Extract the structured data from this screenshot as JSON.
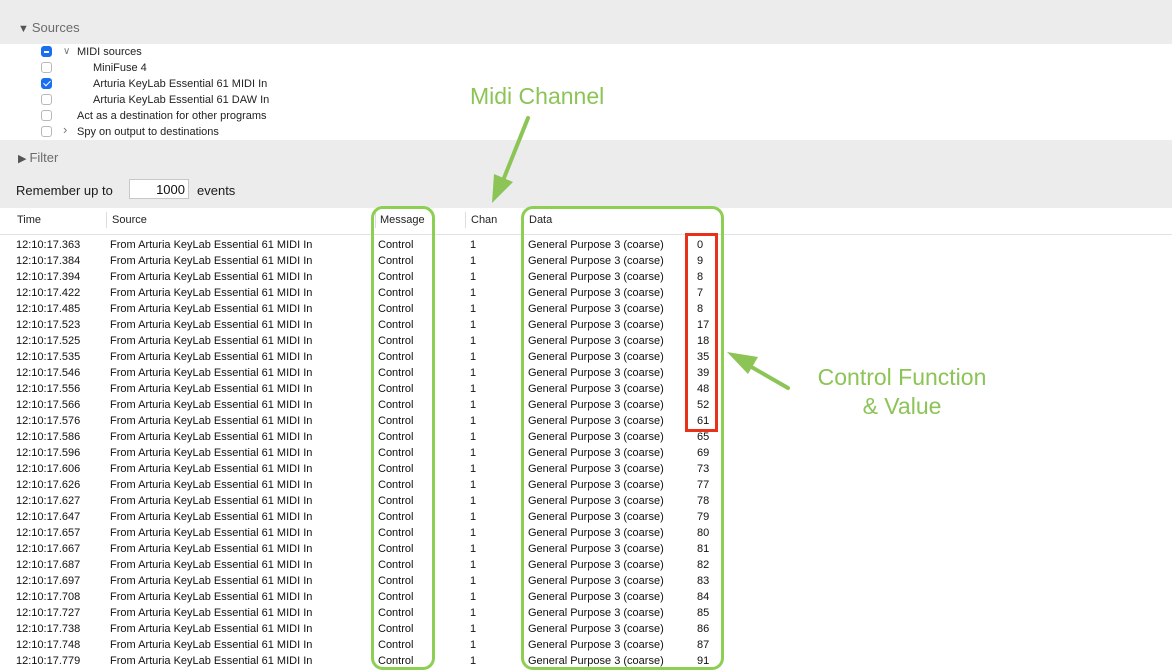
{
  "sources_panel": {
    "title": "Sources",
    "items": [
      {
        "label": "MIDI sources",
        "checkbox": "mixed",
        "expander": "down",
        "indent": 0
      },
      {
        "label": "MiniFuse 4",
        "checkbox": "unchecked",
        "expander": "",
        "indent": 1
      },
      {
        "label": "Arturia KeyLab Essential 61 MIDI In",
        "checkbox": "checked",
        "expander": "",
        "indent": 1
      },
      {
        "label": "Arturia KeyLab Essential 61 DAW In",
        "checkbox": "unchecked",
        "expander": "",
        "indent": 1
      },
      {
        "label": "Act as a destination for other programs",
        "checkbox": "unchecked",
        "expander": "",
        "indent": 0
      },
      {
        "label": "Spy on output to destinations",
        "checkbox": "unchecked",
        "expander": "right",
        "indent": 0
      }
    ]
  },
  "filter_panel": {
    "title": "Filter"
  },
  "remember": {
    "prefix": "Remember up to",
    "value": "1000",
    "suffix": "events"
  },
  "table": {
    "columns": [
      "Time",
      "Source",
      "Message",
      "Chan",
      "Data"
    ],
    "rows": [
      {
        "time": "12:10:17.363",
        "source": "From Arturia KeyLab Essential 61 MIDI In",
        "message": "Control",
        "chan": "1",
        "data": "General Purpose 3 (coarse)",
        "value": "0"
      },
      {
        "time": "12:10:17.384",
        "source": "From Arturia KeyLab Essential 61 MIDI In",
        "message": "Control",
        "chan": "1",
        "data": "General Purpose 3 (coarse)",
        "value": "9"
      },
      {
        "time": "12:10:17.394",
        "source": "From Arturia KeyLab Essential 61 MIDI In",
        "message": "Control",
        "chan": "1",
        "data": "General Purpose 3 (coarse)",
        "value": "8"
      },
      {
        "time": "12:10:17.422",
        "source": "From Arturia KeyLab Essential 61 MIDI In",
        "message": "Control",
        "chan": "1",
        "data": "General Purpose 3 (coarse)",
        "value": "7"
      },
      {
        "time": "12:10:17.485",
        "source": "From Arturia KeyLab Essential 61 MIDI In",
        "message": "Control",
        "chan": "1",
        "data": "General Purpose 3 (coarse)",
        "value": "8"
      },
      {
        "time": "12:10:17.523",
        "source": "From Arturia KeyLab Essential 61 MIDI In",
        "message": "Control",
        "chan": "1",
        "data": "General Purpose 3 (coarse)",
        "value": "17"
      },
      {
        "time": "12:10:17.525",
        "source": "From Arturia KeyLab Essential 61 MIDI In",
        "message": "Control",
        "chan": "1",
        "data": "General Purpose 3 (coarse)",
        "value": "18"
      },
      {
        "time": "12:10:17.535",
        "source": "From Arturia KeyLab Essential 61 MIDI In",
        "message": "Control",
        "chan": "1",
        "data": "General Purpose 3 (coarse)",
        "value": "35"
      },
      {
        "time": "12:10:17.546",
        "source": "From Arturia KeyLab Essential 61 MIDI In",
        "message": "Control",
        "chan": "1",
        "data": "General Purpose 3 (coarse)",
        "value": "39"
      },
      {
        "time": "12:10:17.556",
        "source": "From Arturia KeyLab Essential 61 MIDI In",
        "message": "Control",
        "chan": "1",
        "data": "General Purpose 3 (coarse)",
        "value": "48"
      },
      {
        "time": "12:10:17.566",
        "source": "From Arturia KeyLab Essential 61 MIDI In",
        "message": "Control",
        "chan": "1",
        "data": "General Purpose 3 (coarse)",
        "value": "52"
      },
      {
        "time": "12:10:17.576",
        "source": "From Arturia KeyLab Essential 61 MIDI In",
        "message": "Control",
        "chan": "1",
        "data": "General Purpose 3 (coarse)",
        "value": "61"
      },
      {
        "time": "12:10:17.586",
        "source": "From Arturia KeyLab Essential 61 MIDI In",
        "message": "Control",
        "chan": "1",
        "data": "General Purpose 3 (coarse)",
        "value": "65"
      },
      {
        "time": "12:10:17.596",
        "source": "From Arturia KeyLab Essential 61 MIDI In",
        "message": "Control",
        "chan": "1",
        "data": "General Purpose 3 (coarse)",
        "value": "69"
      },
      {
        "time": "12:10:17.606",
        "source": "From Arturia KeyLab Essential 61 MIDI In",
        "message": "Control",
        "chan": "1",
        "data": "General Purpose 3 (coarse)",
        "value": "73"
      },
      {
        "time": "12:10:17.626",
        "source": "From Arturia KeyLab Essential 61 MIDI In",
        "message": "Control",
        "chan": "1",
        "data": "General Purpose 3 (coarse)",
        "value": "77"
      },
      {
        "time": "12:10:17.627",
        "source": "From Arturia KeyLab Essential 61 MIDI In",
        "message": "Control",
        "chan": "1",
        "data": "General Purpose 3 (coarse)",
        "value": "78"
      },
      {
        "time": "12:10:17.647",
        "source": "From Arturia KeyLab Essential 61 MIDI In",
        "message": "Control",
        "chan": "1",
        "data": "General Purpose 3 (coarse)",
        "value": "79"
      },
      {
        "time": "12:10:17.657",
        "source": "From Arturia KeyLab Essential 61 MIDI In",
        "message": "Control",
        "chan": "1",
        "data": "General Purpose 3 (coarse)",
        "value": "80"
      },
      {
        "time": "12:10:17.667",
        "source": "From Arturia KeyLab Essential 61 MIDI In",
        "message": "Control",
        "chan": "1",
        "data": "General Purpose 3 (coarse)",
        "value": "81"
      },
      {
        "time": "12:10:17.687",
        "source": "From Arturia KeyLab Essential 61 MIDI In",
        "message": "Control",
        "chan": "1",
        "data": "General Purpose 3 (coarse)",
        "value": "82"
      },
      {
        "time": "12:10:17.697",
        "source": "From Arturia KeyLab Essential 61 MIDI In",
        "message": "Control",
        "chan": "1",
        "data": "General Purpose 3 (coarse)",
        "value": "83"
      },
      {
        "time": "12:10:17.708",
        "source": "From Arturia KeyLab Essential 61 MIDI In",
        "message": "Control",
        "chan": "1",
        "data": "General Purpose 3 (coarse)",
        "value": "84"
      },
      {
        "time": "12:10:17.727",
        "source": "From Arturia KeyLab Essential 61 MIDI In",
        "message": "Control",
        "chan": "1",
        "data": "General Purpose 3 (coarse)",
        "value": "85"
      },
      {
        "time": "12:10:17.738",
        "source": "From Arturia KeyLab Essential 61 MIDI In",
        "message": "Control",
        "chan": "1",
        "data": "General Purpose 3 (coarse)",
        "value": "86"
      },
      {
        "time": "12:10:17.748",
        "source": "From Arturia KeyLab Essential 61 MIDI In",
        "message": "Control",
        "chan": "1",
        "data": "General Purpose 3 (coarse)",
        "value": "87"
      },
      {
        "time": "12:10:17.779",
        "source": "From Arturia KeyLab Essential 61 MIDI In",
        "message": "Control",
        "chan": "1",
        "data": "General Purpose 3 (coarse)",
        "value": "91"
      }
    ]
  },
  "annotations": {
    "midi_channel": "Midi Channel",
    "control_function_line1": "Control Function",
    "control_function_line2": "& Value",
    "highlight_color": "#8ccf52",
    "value_box_color": "#e8311b"
  }
}
